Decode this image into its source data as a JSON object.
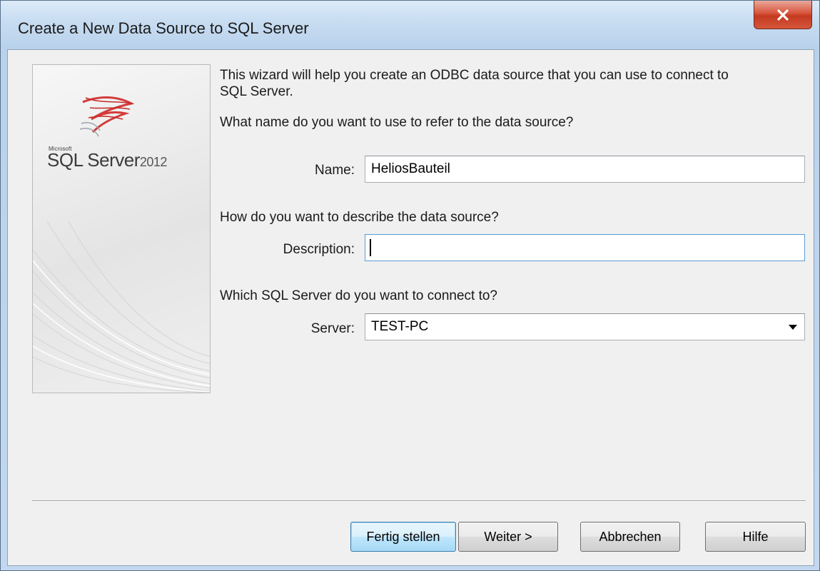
{
  "window": {
    "title": "Create a New Data Source to SQL Server",
    "close_symbol": "x"
  },
  "logo": {
    "company": "Microsoft",
    "product": "SQL Server",
    "version": "2012"
  },
  "intro": {
    "line1": "This wizard will help you create an ODBC data source that you can use to connect to",
    "line2": "SQL Server.",
    "name_question": "What name do you want to use to refer to the data source?"
  },
  "name_field": {
    "label": "Name:",
    "value": "HeliosBauteil"
  },
  "description_section": {
    "question": "How do you want to describe the data source?"
  },
  "description_field": {
    "label": "Description:",
    "value": ""
  },
  "server_section": {
    "question": "Which SQL Server do you want to connect to?"
  },
  "server_field": {
    "label": "Server:",
    "value": "TEST-PC"
  },
  "buttons": {
    "finish": "Fertig stellen",
    "next": "Weiter >",
    "cancel": "Abbrechen",
    "help": "Hilfe"
  },
  "icons": {
    "close": "close-icon",
    "logo": "sql-server-logo-icon",
    "dropdown": "chevron-down-icon"
  }
}
